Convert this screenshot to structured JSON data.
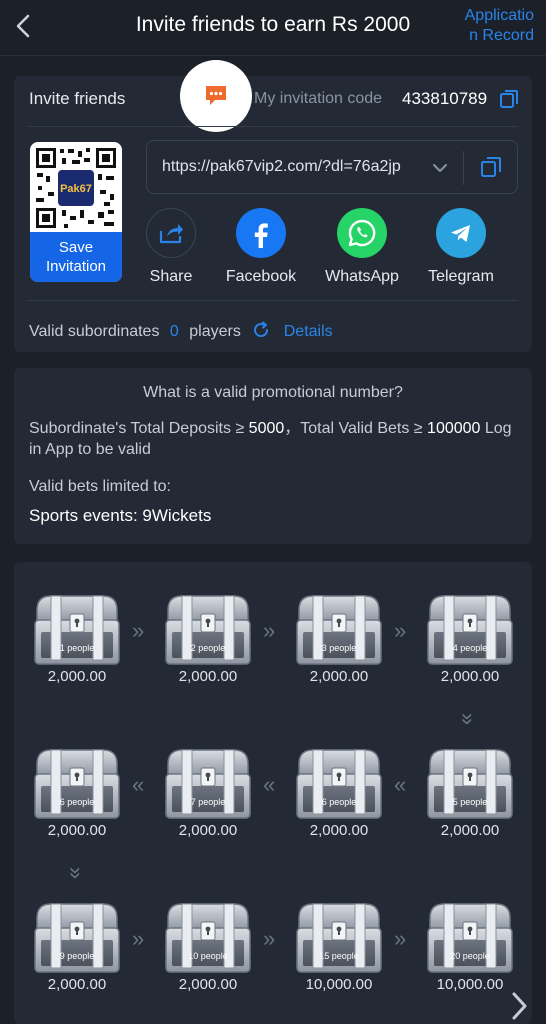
{
  "header": {
    "title": "Invite friends to earn Rs 2000",
    "app_record_line1": "Applicatio",
    "app_record_line2": "n Record"
  },
  "invite": {
    "title": "Invite friends",
    "code_label": "My invitation code",
    "code_value": "433810789",
    "qr_brand": "Pak67",
    "save_line1": "Save",
    "save_line2": "Invitation",
    "link": "https://pak67vip2.com/?dl=76a2jp",
    "share": [
      {
        "label": "Share",
        "icon": "share-icon",
        "color": "#242a35"
      },
      {
        "label": "Facebook",
        "icon": "facebook-icon",
        "color": "#1877f2"
      },
      {
        "label": "WhatsApp",
        "icon": "whatsapp-icon",
        "color": "#25d366"
      },
      {
        "label": "Telegram",
        "icon": "telegram-icon",
        "color": "#2aa3de"
      }
    ],
    "valid_label": "Valid subordinates",
    "valid_count": "0",
    "valid_unit": "players",
    "details": "Details"
  },
  "promo": {
    "title": "What is a valid promotional number?",
    "line_part1": "Subordinate's Total Deposits ≥ ",
    "deposit_min": "5000",
    "line_part2": "，Total Valid Bets ≥ ",
    "bet_min": "100000",
    "line_part3": " Log in App to be valid",
    "limit_label": "Valid bets limited to:",
    "sports_label": "Sports events: ",
    "sports_value": "9Wickets"
  },
  "chests": [
    {
      "people": "1 people",
      "amount": "2,000.00"
    },
    {
      "people": "2 people",
      "amount": "2,000.00"
    },
    {
      "people": "3 people",
      "amount": "2,000.00"
    },
    {
      "people": "4 people",
      "amount": "2,000.00"
    },
    {
      "people": "6 people",
      "amount": "2,000.00"
    },
    {
      "people": "7 people",
      "amount": "2,000.00"
    },
    {
      "people": "6 people",
      "amount": "2,000.00"
    },
    {
      "people": "5 people",
      "amount": "2,000.00"
    },
    {
      "people": "9 people",
      "amount": "2,000.00"
    },
    {
      "people": "10 people",
      "amount": "2,000.00"
    },
    {
      "people": "15 people",
      "amount": "10,000.00"
    },
    {
      "people": "20 people",
      "amount": "10,000.00"
    }
  ],
  "colors": {
    "background": "#1b2029",
    "card": "#242a35",
    "accent": "#2a84e8",
    "save_button": "#1466e6"
  }
}
